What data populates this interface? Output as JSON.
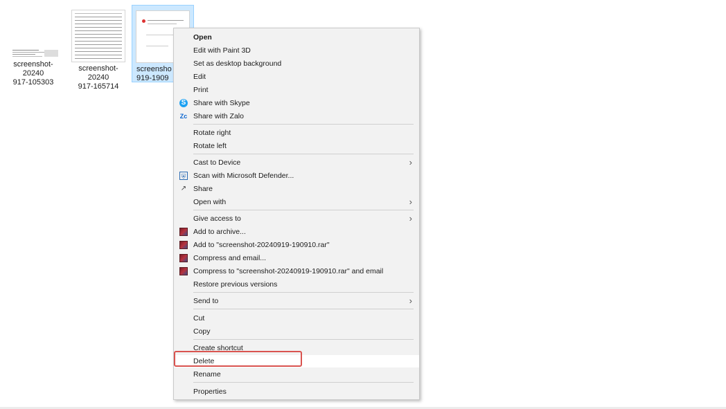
{
  "desktop": {
    "files": [
      {
        "name_line1": "screenshot-20240",
        "name_line2": "917-105303"
      },
      {
        "name_line1": "screenshot-20240",
        "name_line2": "917-165714"
      },
      {
        "name_line1": "screensho",
        "name_line2": "919-1909"
      }
    ]
  },
  "context_menu": {
    "items": [
      {
        "label": "Open"
      },
      {
        "label": "Edit with Paint 3D"
      },
      {
        "label": "Set as desktop background"
      },
      {
        "label": "Edit"
      },
      {
        "label": "Print"
      },
      {
        "label": "Share with Skype",
        "icon": "skype-icon"
      },
      {
        "label": "Share with Zalo",
        "icon": "zalo-icon"
      },
      {
        "label": "Rotate right"
      },
      {
        "label": "Rotate left"
      },
      {
        "label": "Cast to Device",
        "arrow": "›"
      },
      {
        "label": "Scan with Microsoft Defender...",
        "icon": "defender-icon"
      },
      {
        "label": "Share",
        "icon": "share-icon"
      },
      {
        "label": "Open with",
        "arrow": "›"
      },
      {
        "label": "Give access to",
        "arrow": "›"
      },
      {
        "label": "Add to archive...",
        "icon": "winrar-icon"
      },
      {
        "label": "Add to \"screenshot-20240919-190910.rar\"",
        "icon": "winrar-icon"
      },
      {
        "label": "Compress and email...",
        "icon": "winrar-icon"
      },
      {
        "label": "Compress to \"screenshot-20240919-190910.rar\" and email",
        "icon": "winrar-icon"
      },
      {
        "label": "Restore previous versions"
      },
      {
        "label": "Send to",
        "arrow": "›"
      },
      {
        "label": "Cut"
      },
      {
        "label": "Copy"
      },
      {
        "label": "Create shortcut"
      },
      {
        "label": "Delete"
      },
      {
        "label": "Rename"
      },
      {
        "label": "Properties"
      }
    ]
  },
  "colors": {
    "highlight_border": "#d9534f",
    "selection_bg": "#cce8ff"
  }
}
